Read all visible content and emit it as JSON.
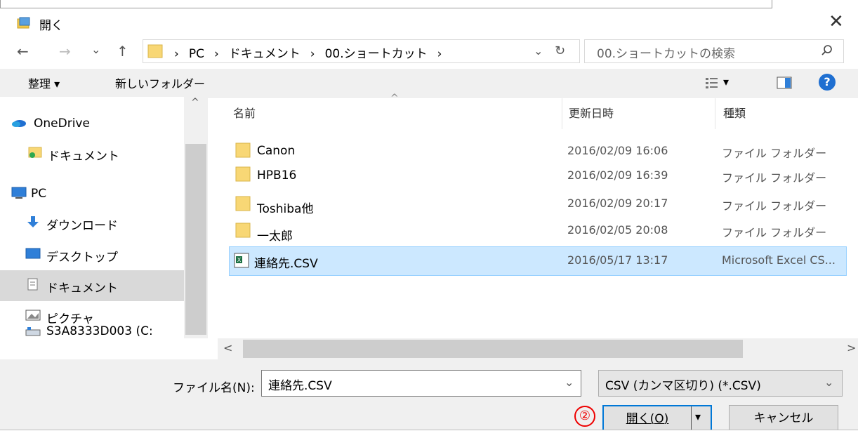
{
  "window": {
    "title": "開く",
    "close_glyph": "✕"
  },
  "nav": {
    "back": "←",
    "forward": "→",
    "recent": "⌄",
    "up": "↑",
    "addr_dropdown": "⌄",
    "refresh": "↻"
  },
  "breadcrumb": [
    {
      "sep": "›",
      "label": "PC"
    },
    {
      "sep": "›",
      "label": "ドキュメント"
    },
    {
      "sep": "›",
      "label": "00.ショートカット"
    },
    {
      "sep": "›",
      "label": ""
    }
  ],
  "search": {
    "placeholder": "00.ショートカットの検索"
  },
  "toolbar": {
    "organize": "整理 ▾",
    "new_folder": "新しいフォルダー",
    "view_dropdown": "▾",
    "help": "?"
  },
  "sidebar": {
    "items": [
      {
        "label": "OneDrive",
        "icon": "onedrive-icon"
      },
      {
        "label": "ドキュメント",
        "icon": "document-folder-icon"
      },
      {
        "label": "PC",
        "icon": "pc-icon"
      },
      {
        "label": "ダウンロード",
        "icon": "download-icon"
      },
      {
        "label": "デスクトップ",
        "icon": "desktop-icon"
      },
      {
        "label": "ドキュメント",
        "icon": "documents-icon",
        "selected": true
      },
      {
        "label": "ピクチャ",
        "icon": "pictures-icon"
      },
      {
        "label": "S3A8333D003 (C:",
        "icon": "drive-icon"
      }
    ],
    "scroll_up": "^"
  },
  "columns": {
    "name": "名前",
    "modified": "更新日時",
    "type": "種類",
    "sort_glyph": "^"
  },
  "files": [
    {
      "name": "Canon",
      "modified": "2016/02/09 16:06",
      "type": "ファイル フォルダー",
      "icon": "folder-icon"
    },
    {
      "name": "HPB16",
      "modified": "2016/02/09 16:39",
      "type": "ファイル フォルダー",
      "icon": "folder-icon"
    },
    {
      "name": "Toshiba他",
      "modified": "2016/02/09 20:17",
      "type": "ファイル フォルダー",
      "icon": "folder-icon"
    },
    {
      "name": "一太郎",
      "modified": "2016/02/05 20:08",
      "type": "ファイル フォルダー",
      "icon": "folder-icon"
    },
    {
      "name": "連絡先.CSV",
      "modified": "2016/05/17 13:17",
      "type": "Microsoft Excel CS...",
      "icon": "excel-csv-icon",
      "selected": true
    }
  ],
  "hscroll": {
    "left": "<",
    "right": ">"
  },
  "footer": {
    "filename_label": "ファイル名(N):",
    "filename_value": "連絡先.CSV",
    "filename_dropdown": "⌄",
    "filetype_value": "CSV (カンマ区切り) (*.CSV)",
    "filetype_dropdown": "⌄",
    "open_button": "開く(O)",
    "open_split": "▾",
    "cancel_button": "キャンセル",
    "step_badge": "②"
  },
  "colors": {
    "selection": "#cce8ff",
    "folder": "#f8d775",
    "accent": "#0078d7",
    "badge": "#e00000"
  }
}
